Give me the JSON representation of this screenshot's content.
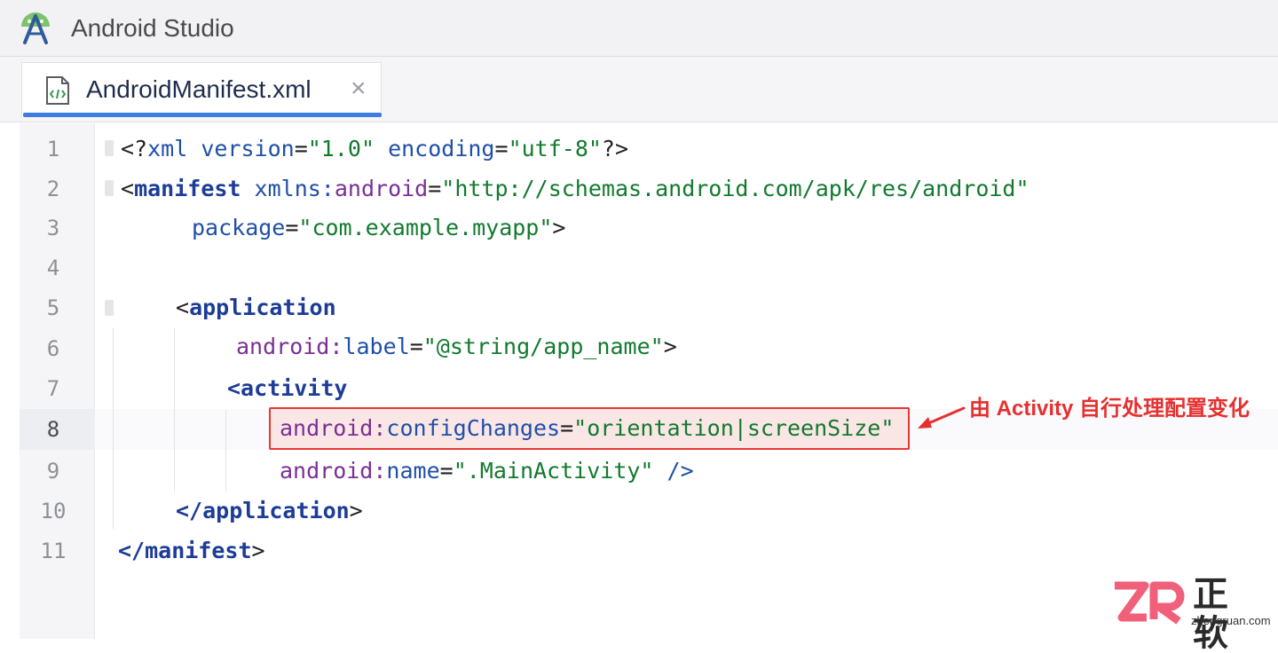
{
  "window": {
    "title": "Android Studio"
  },
  "tab": {
    "label": "AndroidManifest.xml",
    "close": "×"
  },
  "editor": {
    "line_numbers": [
      "1",
      "2",
      "3",
      "4",
      "5",
      "6",
      "7",
      "8",
      "9",
      "10",
      "11"
    ],
    "current_line": "8",
    "lines": [
      [
        [
          "pu",
          "<?"
        ],
        [
          "aa",
          "xml"
        ],
        [
          "pu",
          " "
        ],
        [
          "aa",
          "version"
        ],
        [
          "pu",
          "="
        ],
        [
          "sv",
          "\"1.0\""
        ],
        [
          "pu",
          " "
        ],
        [
          "aa",
          "encoding"
        ],
        [
          "pu",
          "="
        ],
        [
          "sv",
          "\"utf-8\""
        ],
        [
          "pu",
          "?>"
        ]
      ],
      [
        [
          "pu",
          "<"
        ],
        [
          "tg",
          "manifest"
        ],
        [
          "pu",
          " "
        ],
        [
          "aa",
          "xmlns:"
        ],
        [
          "an",
          "android"
        ],
        [
          "pu",
          "="
        ],
        [
          "sv",
          "\"http://schemas.android.com/apk/res/android\""
        ]
      ],
      [
        [
          "aa",
          "package"
        ],
        [
          "pu",
          "="
        ],
        [
          "sv",
          "\"com.example.myapp\""
        ],
        [
          "pu",
          ">"
        ]
      ],
      [],
      [
        [
          "pu",
          "<"
        ],
        [
          "tg",
          "application"
        ]
      ],
      [
        [
          "an",
          "android:"
        ],
        [
          "aa",
          "label"
        ],
        [
          "pu",
          "="
        ],
        [
          "sv",
          "\"@string/app_name\""
        ],
        [
          "pu",
          ">"
        ]
      ],
      [
        [
          "tg",
          "<activity"
        ]
      ],
      [
        [
          "an",
          "android:"
        ],
        [
          "aa",
          "configChanges"
        ],
        [
          "pu",
          "="
        ],
        [
          "sv",
          "\"orientation|screenSize\""
        ]
      ],
      [
        [
          "an",
          "android:"
        ],
        [
          "aa",
          "name"
        ],
        [
          "pu",
          "="
        ],
        [
          "sv",
          "\".MainActivity\""
        ],
        [
          "pu",
          " "
        ],
        [
          "aa",
          "/>"
        ]
      ],
      [
        [
          "tg",
          "</application"
        ],
        [
          "pu",
          ">"
        ]
      ],
      [
        [
          "tg",
          "</manifest"
        ],
        [
          "pu",
          ">"
        ]
      ]
    ]
  },
  "annotation": {
    "text": "由 Activity 自行处理配置变化",
    "color": "#e53030"
  },
  "watermark": {
    "brand": "正软",
    "url": "zhengruan.com"
  },
  "colors": {
    "tag": "#1c3c97",
    "namespace": "#7b2f96",
    "attr": "#1f4fa8",
    "string": "#127a2e",
    "accent": "#3d7de0"
  }
}
